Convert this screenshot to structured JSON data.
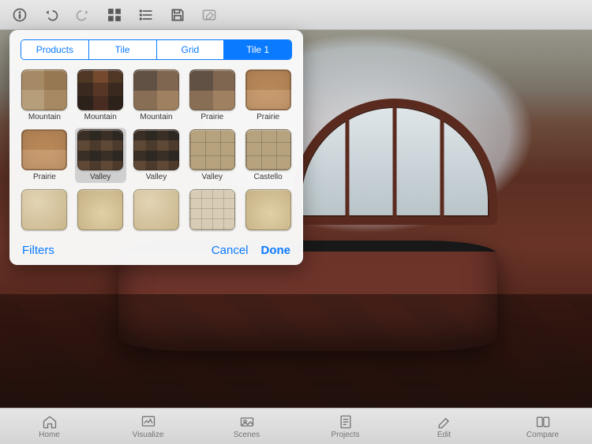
{
  "colors": {
    "accent": "#0a7aff"
  },
  "toolbar": {
    "icons": [
      "info",
      "undo",
      "redo",
      "grid",
      "list",
      "save",
      "edit"
    ]
  },
  "popover": {
    "tabs": [
      "Products",
      "Tile",
      "Grid",
      "Tile 1"
    ],
    "active_tab_index": 3,
    "selected_swatch_index": 6,
    "swatches": [
      {
        "label": "Mountain",
        "tex": "t-tan"
      },
      {
        "label": "Mountain",
        "tex": "t-dark"
      },
      {
        "label": "Mountain",
        "tex": "t-dark2"
      },
      {
        "label": "Prairie",
        "tex": "t-dark2"
      },
      {
        "label": "Prairie",
        "tex": "t-terra"
      },
      {
        "label": "Prairie",
        "tex": "t-terra"
      },
      {
        "label": "Valley",
        "tex": "t-dark3"
      },
      {
        "label": "Valley",
        "tex": "t-dark3"
      },
      {
        "label": "Valley",
        "tex": "t-terra-grid"
      },
      {
        "label": "Castello",
        "tex": "t-terra-grid"
      },
      {
        "label": "",
        "tex": "t-beige"
      },
      {
        "label": "",
        "tex": "t-beige2"
      },
      {
        "label": "",
        "tex": "t-beige"
      },
      {
        "label": "",
        "tex": "t-cream-grid"
      },
      {
        "label": "",
        "tex": "t-beige2"
      }
    ],
    "filters_label": "Filters",
    "cancel_label": "Cancel",
    "done_label": "Done"
  },
  "tabs": [
    {
      "label": "Home",
      "icon": "home"
    },
    {
      "label": "Visualize",
      "icon": "visualize"
    },
    {
      "label": "Scenes",
      "icon": "scenes"
    },
    {
      "label": "Projects",
      "icon": "projects"
    },
    {
      "label": "Edit",
      "icon": "edit"
    },
    {
      "label": "Compare",
      "icon": "compare"
    }
  ]
}
